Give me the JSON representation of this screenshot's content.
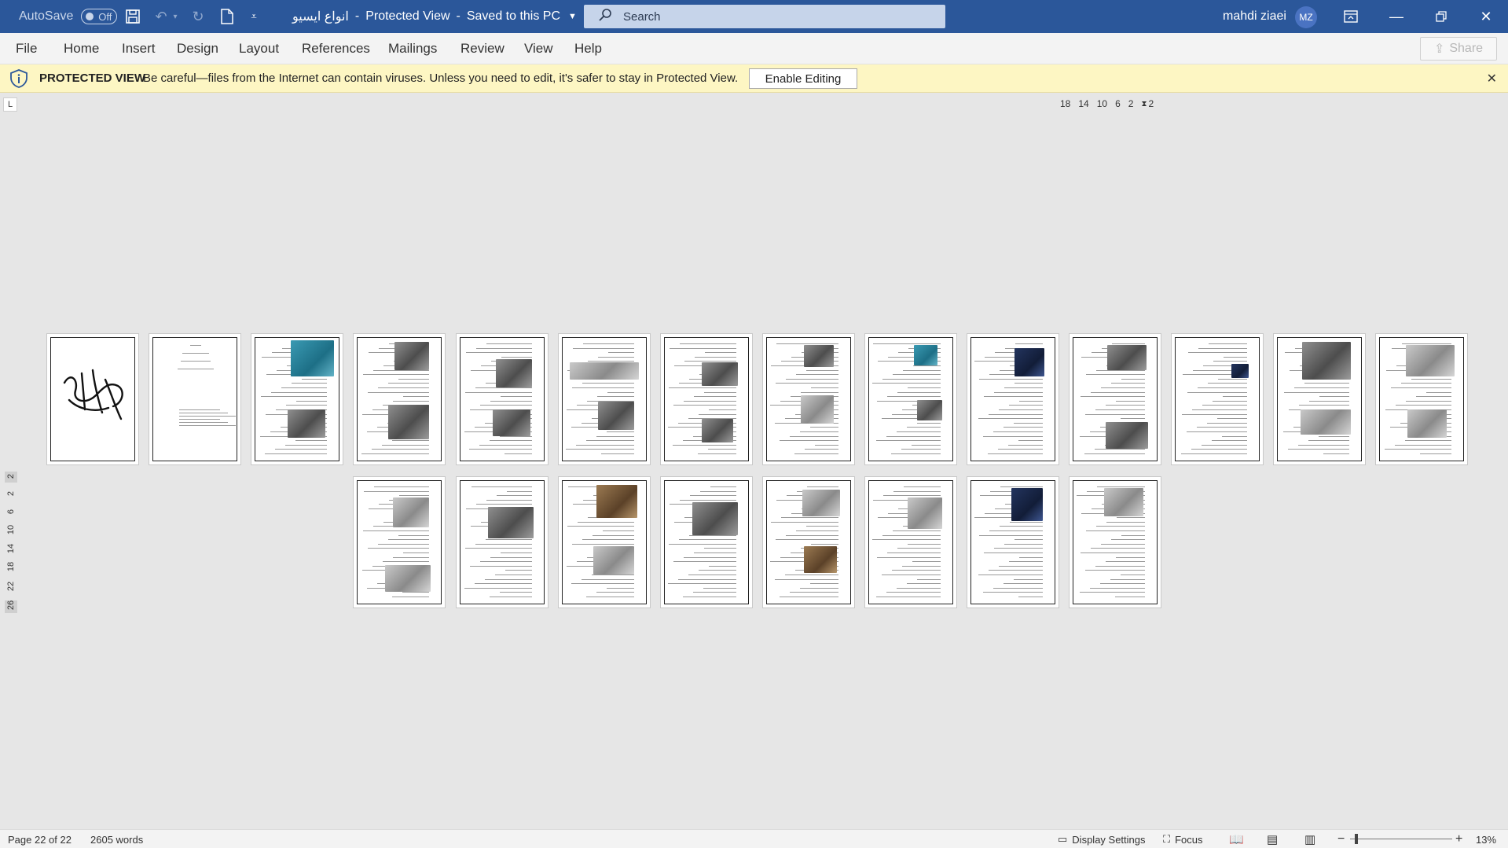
{
  "titlebar": {
    "autosave_label": "AutoSave",
    "autosave_state": "Off",
    "doc_name": "انواع ایسیو",
    "view_mode": "Protected View",
    "save_status": "Saved to this PC",
    "search_placeholder": "Search",
    "user_name": "mahdi ziaei",
    "user_initials": "MZ"
  },
  "ribbon": {
    "tabs": [
      "File",
      "Home",
      "Insert",
      "Design",
      "Layout",
      "References",
      "Mailings",
      "Review",
      "View",
      "Help"
    ],
    "share_label": "Share"
  },
  "protected_bar": {
    "label": "PROTECTED VIEW",
    "message": "Be careful—files from the Internet can contain viruses. Unless you need to edit, it's safer to stay in Protected View.",
    "button": "Enable Editing"
  },
  "rulers": {
    "corner": "L",
    "horizontal": [
      "18",
      "14",
      "10",
      "6",
      "2",
      "2"
    ],
    "vertical": [
      "2",
      "2",
      "6",
      "10",
      "14",
      "18",
      "22",
      "26"
    ]
  },
  "statusbar": {
    "page_info": "Page 22 of 22",
    "word_count": "2605 words",
    "display_settings": "Display Settings",
    "focus": "Focus",
    "zoom": "13%"
  },
  "colors": {
    "titlebar": "#2b579a",
    "protected_bar": "#fdf6c3",
    "workspace": "#e6e6e6"
  },
  "pages_shown": 22
}
